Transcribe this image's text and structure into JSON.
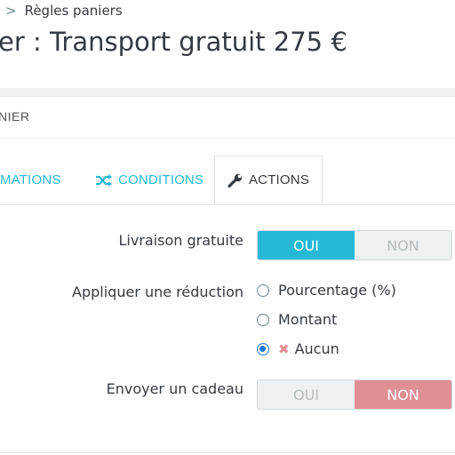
{
  "breadcrumb": {
    "separator": ">",
    "current": "Règles paniers"
  },
  "page": {
    "title": "er : Transport gratuit 275 €"
  },
  "panel": {
    "heading": "NIER"
  },
  "tabs": [
    {
      "label": "MATIONS",
      "icon": "info-icon"
    },
    {
      "label": "CONDITIONS",
      "icon": "shuffle-icon"
    },
    {
      "label": "ACTIONS",
      "icon": "wrench-icon",
      "active": true
    }
  ],
  "form": {
    "free_shipping": {
      "label": "Livraison gratuite",
      "yes": "OUI",
      "no": "NON",
      "value": "OUI"
    },
    "discount": {
      "label": "Appliquer une réduction",
      "options": [
        "Pourcentage (%)",
        "Montant",
        "Aucun"
      ],
      "selected": "Aucun"
    },
    "gift": {
      "label": "Envoyer un cadeau",
      "yes": "OUI",
      "no": "NON",
      "value": "NON"
    }
  },
  "colors": {
    "accent": "#25b9d7",
    "danger": "#e08f95",
    "radio": "#2575d9"
  }
}
